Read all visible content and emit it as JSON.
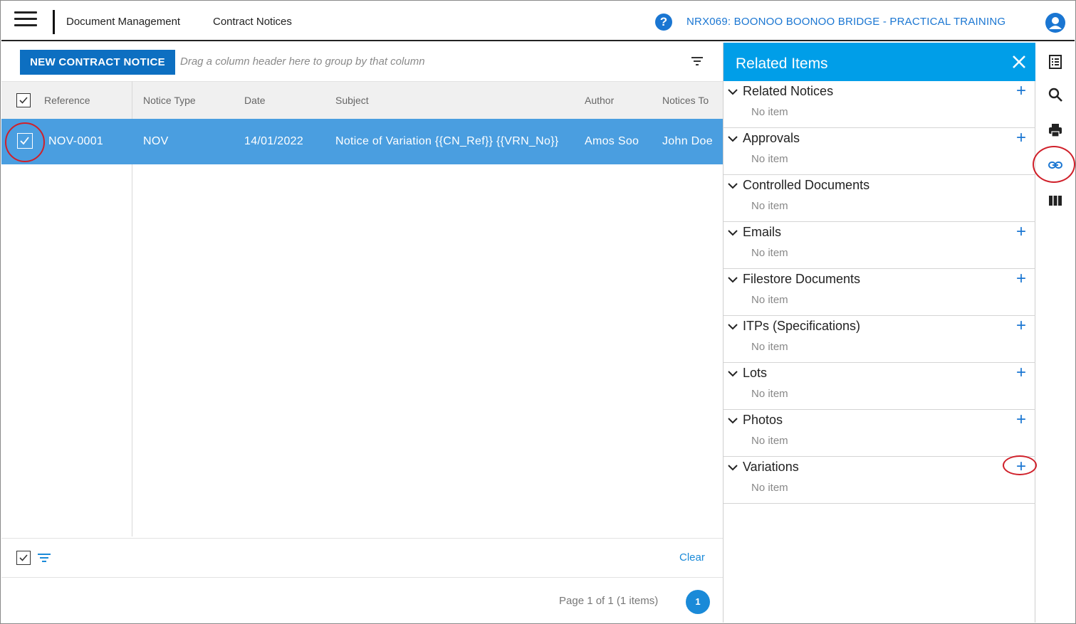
{
  "header": {
    "breadcrumb": [
      "Document Management",
      "Contract Notices"
    ],
    "project": "NRX069: BOONOO BOONOO BRIDGE - PRACTICAL TRAINING"
  },
  "toolbar": {
    "new_button": "NEW CONTRACT NOTICE",
    "group_hint": "Drag a column header here to group by that column"
  },
  "grid": {
    "columns": [
      "Reference",
      "Notice Type",
      "Date",
      "Subject",
      "Author",
      "Notices To"
    ],
    "rows": [
      {
        "reference": "NOV-0001",
        "notice_type": "NOV",
        "date": "14/01/2022",
        "subject": "Notice of Variation {{CN_Ref}} {{VRN_No}}",
        "author": "Amos Soo",
        "notices_to": "John Doe",
        "selected": true
      }
    ]
  },
  "filter_bar": {
    "clear_label": "Clear"
  },
  "pager": {
    "summary": "Page 1 of 1 (1 items)",
    "current_page": "1"
  },
  "related_panel": {
    "title": "Related Items",
    "sections": [
      {
        "title": "Related Notices",
        "empty": "No item",
        "can_add": true
      },
      {
        "title": "Approvals",
        "empty": "No item",
        "can_add": true
      },
      {
        "title": "Controlled Documents",
        "empty": "No item",
        "can_add": false
      },
      {
        "title": "Emails",
        "empty": "No item",
        "can_add": true
      },
      {
        "title": "Filestore Documents",
        "empty": "No item",
        "can_add": true
      },
      {
        "title": "ITPs (Specifications)",
        "empty": "No item",
        "can_add": true
      },
      {
        "title": "Lots",
        "empty": "No item",
        "can_add": true
      },
      {
        "title": "Photos",
        "empty": "No item",
        "can_add": true
      },
      {
        "title": "Variations",
        "empty": "No item",
        "can_add": true
      }
    ]
  },
  "rail_icons": [
    "details-icon",
    "search-icon",
    "print-icon",
    "link-icon",
    "columns-icon"
  ],
  "colors": {
    "accent": "#1a76d2",
    "panel_header": "#009ee8",
    "selected_row": "#4a9ee0",
    "primary_button": "#0d6fc1",
    "annotation": "#d0202a"
  }
}
